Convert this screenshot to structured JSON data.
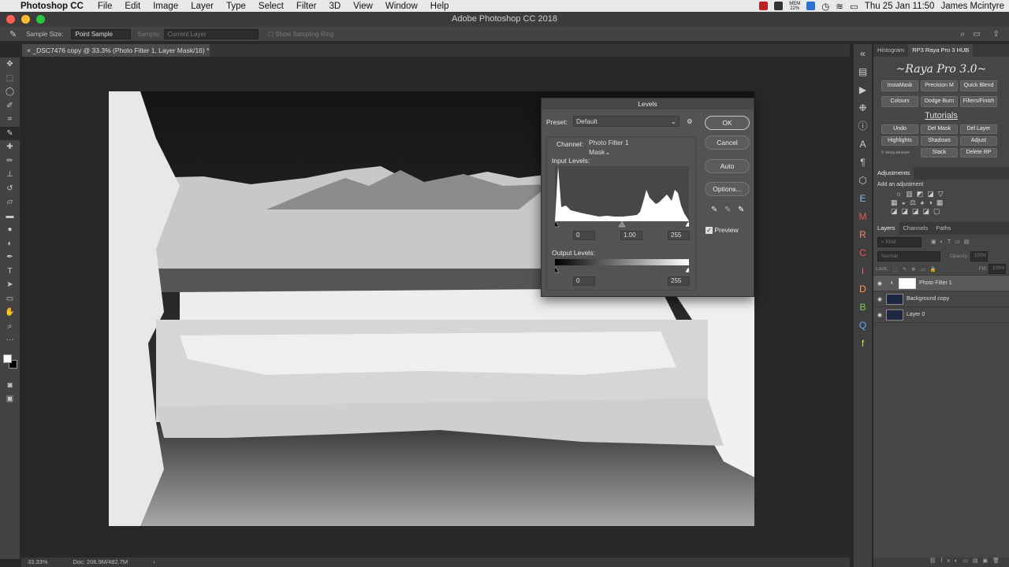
{
  "menubar": {
    "app_name": "Photoshop CC",
    "items": [
      "File",
      "Edit",
      "Image",
      "Layer",
      "Type",
      "Select",
      "Filter",
      "3D",
      "View",
      "Window",
      "Help"
    ],
    "mem_label": "MEM",
    "mem_value": "22%",
    "clock": "Thu 25 Jan  11:50",
    "user": "James Mcintyre"
  },
  "window": {
    "title": "Adobe Photoshop CC 2018"
  },
  "options_bar": {
    "sample_size_label": "Sample Size:",
    "sample_size_value": "Point Sample",
    "sample_label": "Sample:",
    "sample_value": "Current Layer",
    "show_ring_label": "Show Sampling Ring"
  },
  "document": {
    "tab_title": "_DSC7476 copy @ 33.3% (Photo Filter 1, Layer Mask/16) *"
  },
  "status": {
    "zoom": "33.33%",
    "doc_size": "Doc: 206.9M/482.7M"
  },
  "levels": {
    "title": "Levels",
    "preset_label": "Preset:",
    "preset_value": "Default",
    "channel_label": "Channel:",
    "channel_value": "Photo Filter 1 Mask",
    "input_label": "Input Levels:",
    "input_black": "0",
    "input_gamma": "1.00",
    "input_white": "255",
    "output_label": "Output Levels:",
    "output_black": "0",
    "output_white": "255",
    "buttons": {
      "ok": "OK",
      "cancel": "Cancel",
      "auto": "Auto",
      "options": "Options..."
    },
    "preview_label": "Preview"
  },
  "right_panel": {
    "tabs": [
      "Histogram",
      "RP3 Raya Pro 3 HUB"
    ],
    "raya_title": "~Raya Pro 3.0~",
    "row1": [
      "InstaMask",
      "Precision M",
      "Quick Blend"
    ],
    "row2": [
      "Colours",
      "Dodge Burn",
      "Filters/Finish"
    ],
    "tutorials": "Tutorials",
    "row3": [
      "Undo",
      "Del Mask",
      "Del Layer"
    ],
    "row4": [
      "Highlights",
      "Shadows",
      "Adjust"
    ],
    "row5": [
      "Stack",
      "Delete RP"
    ],
    "credit": "© Jimmy Mcintyre",
    "adjustments_tab": "Adjustments",
    "add_adjustment": "Add an adjustment",
    "layer_tabs": [
      "Layers",
      "Channels",
      "Paths"
    ],
    "kind_label": "Kind",
    "blend_mode": "Normal",
    "opacity_label": "Opacity:",
    "opacity_value": "100%",
    "lock_label": "Lock:",
    "fill_label": "Fill:",
    "fill_value": "100%",
    "layers": [
      "Photo Filter 1",
      "Background copy",
      "Layer 0"
    ]
  },
  "colors": {
    "accent_ok": "#c9c9c9",
    "panel": "#464646",
    "dialog": "#535353"
  }
}
